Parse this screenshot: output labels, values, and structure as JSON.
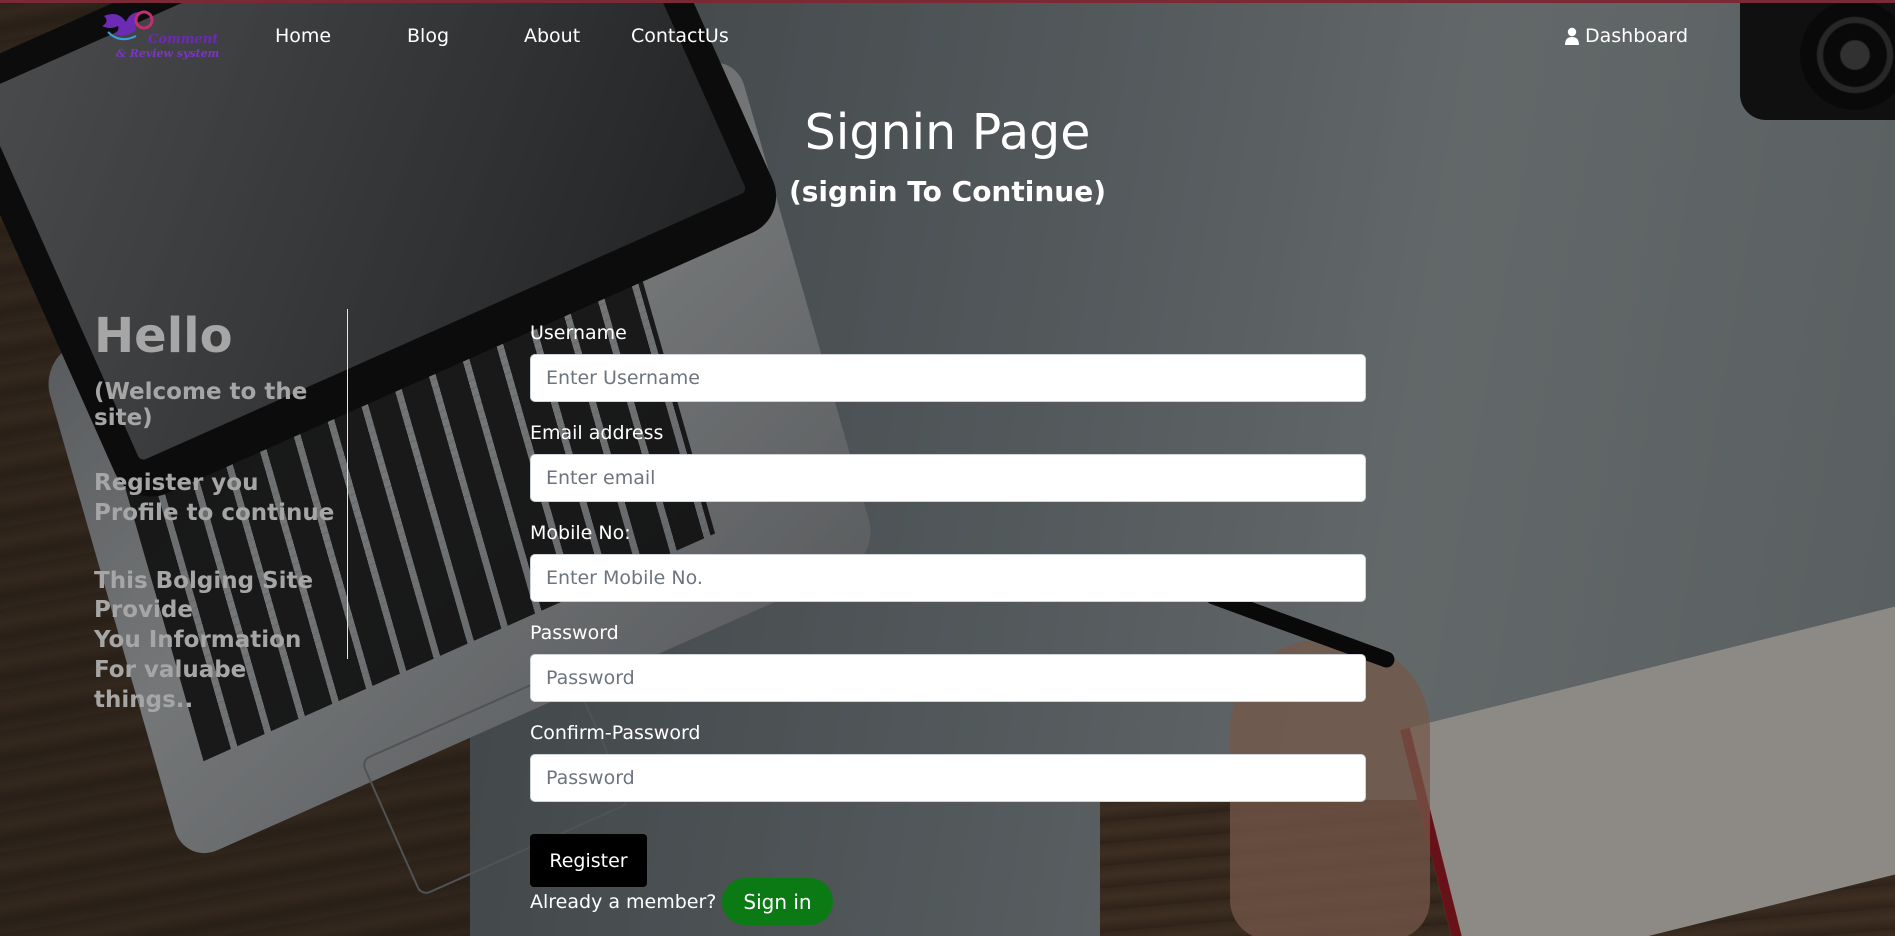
{
  "nav": {
    "logo_line1": "Comment",
    "logo_line2": "& Review system",
    "home": "Home",
    "blog": "Blog",
    "about": "About",
    "contact": "ContactUs",
    "dashboard": "Dashboard"
  },
  "header": {
    "title": "Signin Page",
    "subtitle": "(signin To Continue)"
  },
  "intro": {
    "hello": "Hello",
    "welcome": "(Welcome to the site)",
    "register": "Register you Profile to continue",
    "about_line1": "This Bolging Site Provide",
    "about_line2": "You Information For valuabe things.."
  },
  "form": {
    "username_label": "Username",
    "username_placeholder": "Enter Username",
    "email_label": "Email address",
    "email_placeholder": "Enter email",
    "mobile_label": "Mobile No:",
    "mobile_placeholder": "Enter Mobile No.",
    "password_label": "Password",
    "password_placeholder": "Password",
    "confirm_label": "Confirm-Password",
    "confirm_placeholder": "Password",
    "register_button": "Register",
    "member_text": "Already a member?",
    "signin_button": "Sign in"
  },
  "colors": {
    "signin_button": "#0c7a14",
    "register_button": "#000000",
    "logo_purple": "#6c2bb3"
  },
  "icons": {
    "dashboard": "user-icon",
    "logo": "bird-logo-icon"
  }
}
